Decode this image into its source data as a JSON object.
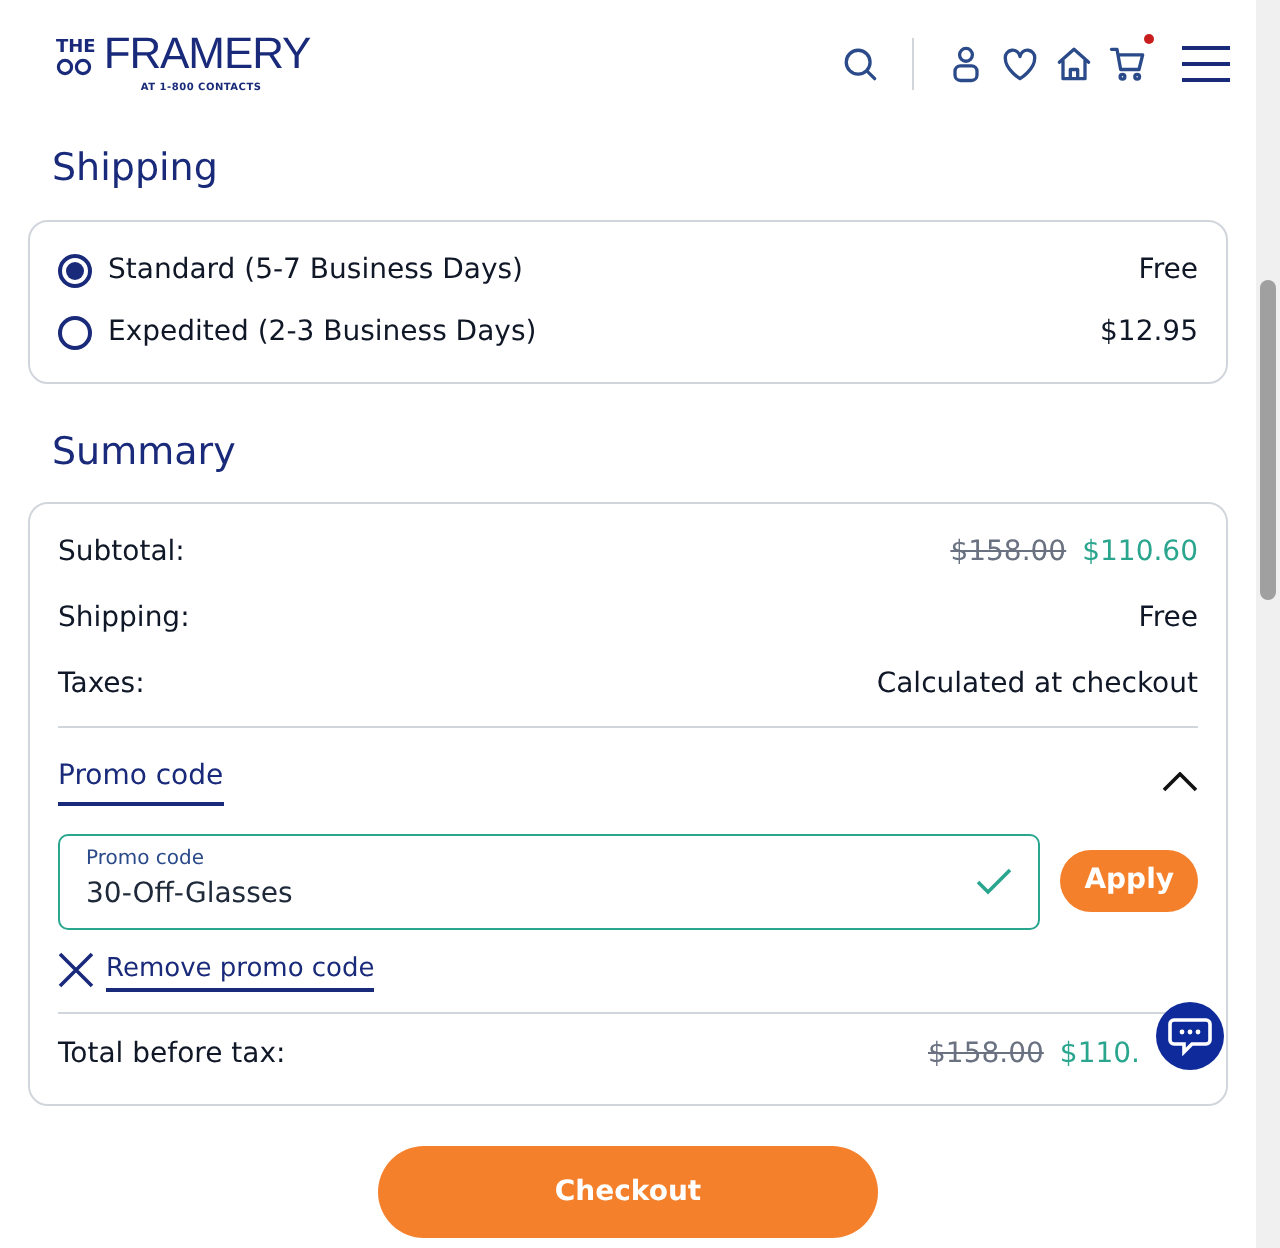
{
  "header": {
    "logo": {
      "top": "THE",
      "name": "FRAMERY",
      "tagline": "AT 1-800 CONTACTS"
    },
    "cart_notification": true
  },
  "shipping": {
    "title": "Shipping",
    "options": [
      {
        "label": "Standard (5-7 Business Days)",
        "price": "Free",
        "selected": true
      },
      {
        "label": "Expedited (2-3 Business Days)",
        "price": "$12.95",
        "selected": false
      }
    ]
  },
  "summary": {
    "title": "Summary",
    "rows": [
      {
        "label": "Subtotal:",
        "old_value": "$158.00",
        "value": "$110.60"
      },
      {
        "label": "Shipping:",
        "value": "Free"
      },
      {
        "label": "Taxes:",
        "value": "Calculated at checkout"
      }
    ],
    "promo": {
      "toggle": "Promo code",
      "expanded": true,
      "field_label": "Promo code",
      "value": "30-Off-Glasses",
      "valid": true,
      "apply": "Apply",
      "remove": "Remove promo code"
    },
    "total": {
      "label": "Total before tax:",
      "old_value": "$158.00",
      "value": "$110."
    }
  },
  "checkout": "Checkout"
}
